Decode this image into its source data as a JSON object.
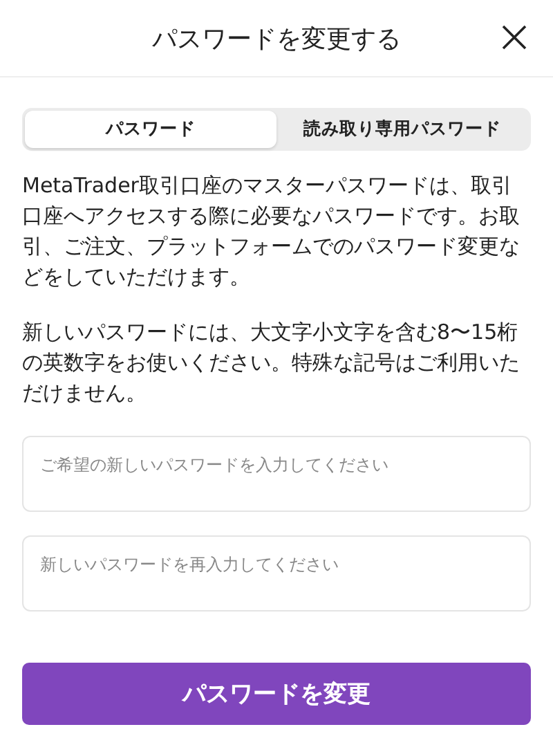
{
  "header": {
    "title": "パスワードを変更する"
  },
  "tabs": [
    {
      "label": "パスワード",
      "selected": true
    },
    {
      "label": "読み取り専用パスワード",
      "selected": false
    }
  ],
  "paragraphs": [
    "MetaTrader取引口座のマスターパスワードは、取引口座へアクセスする際に必要なパスワードです。お取引、ご注文、プラットフォームでのパスワード変更などをしていただけます。",
    "新しいパスワードには、大文字小文字を含む8〜15桁の英数字をお使いください。特殊な記号はご利用いただけません。"
  ],
  "fields": [
    {
      "placeholder": "ご希望の新しいパスワードを入力してください"
    },
    {
      "placeholder": "新しいパスワードを再入力してください"
    }
  ],
  "submit_button": {
    "label": "パスワードを変更"
  }
}
